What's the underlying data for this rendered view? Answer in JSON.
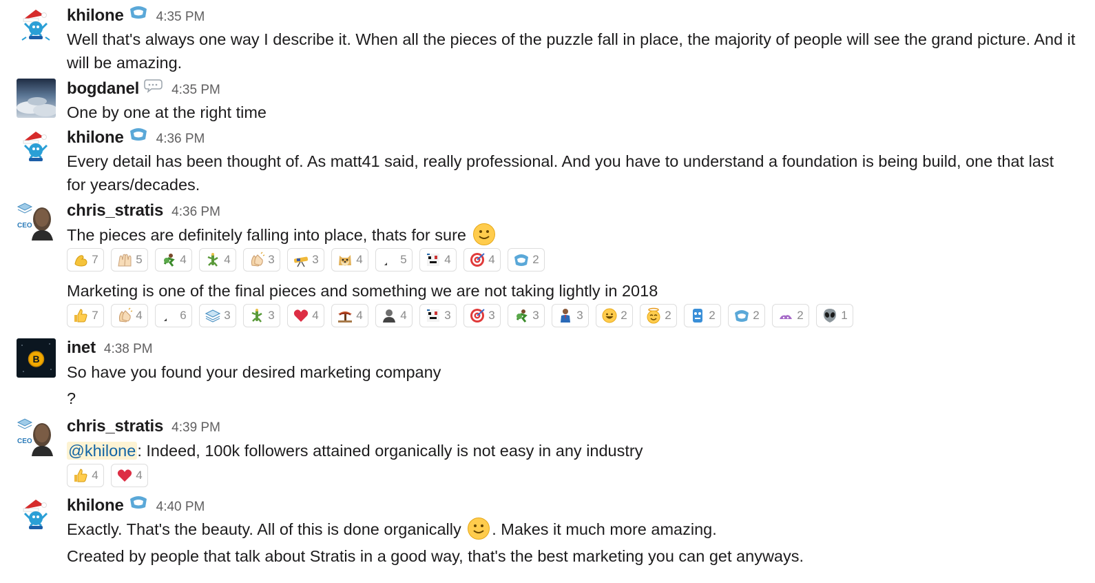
{
  "messages": [
    {
      "author": "khilone",
      "time": "4:35 PM",
      "lines": [
        "Well that's always one way I describe it. When all the pieces of the puzzle fall in place, the majority of people will see the grand picture. And it will be amazing."
      ]
    },
    {
      "author": "bogdanel",
      "time": "4:35 PM",
      "lines": [
        "One by one at the right time"
      ]
    },
    {
      "author": "khilone",
      "time": "4:36 PM",
      "lines": [
        "Every detail has been thought of. As matt41 said, really professional. And you have to understand a foundation is being build, one that last for years/decades."
      ]
    },
    {
      "author": "chris_stratis",
      "time": "4:36 PM",
      "line1": "The pieces are definitely falling into place, thats for sure",
      "reactions1": [
        {
          "icon": "flexed-biceps-icon",
          "count": "7"
        },
        {
          "icon": "raised-hands-icon",
          "count": "5"
        },
        {
          "icon": "dancer-icon",
          "count": "4"
        },
        {
          "icon": "cactus-dance-icon",
          "count": "4"
        },
        {
          "icon": "clapping-hands-icon",
          "count": "3"
        },
        {
          "icon": "telescope-icon",
          "count": "3"
        },
        {
          "icon": "doge-icon",
          "count": "4"
        },
        {
          "icon": "blank-emoji-icon",
          "count": "5"
        },
        {
          "icon": "face-glitch-icon",
          "count": "4"
        },
        {
          "icon": "target-icon",
          "count": "4"
        },
        {
          "icon": "stratis-logo-icon",
          "count": "2"
        }
      ],
      "line2": "Marketing is one of the final pieces and something we are not taking lightly in 2018",
      "reactions2": [
        {
          "icon": "thumbs-up-icon",
          "count": "7"
        },
        {
          "icon": "clapping-hands-icon",
          "count": "4"
        },
        {
          "icon": "blank-emoji-icon",
          "count": "6"
        },
        {
          "icon": "stratis-layers-icon",
          "count": "3"
        },
        {
          "icon": "cactus-dance-icon",
          "count": "3"
        },
        {
          "icon": "red-heart-icon",
          "count": "4"
        },
        {
          "icon": "tree-icon",
          "count": "4"
        },
        {
          "icon": "person-bust-icon",
          "count": "4"
        },
        {
          "icon": "face-glitch-icon",
          "count": "3"
        },
        {
          "icon": "target-icon",
          "count": "3"
        },
        {
          "icon": "dancer-icon",
          "count": "3"
        },
        {
          "icon": "businessman-icon",
          "count": "3"
        },
        {
          "icon": "grinning-face-icon",
          "count": "2"
        },
        {
          "icon": "smiling-halo-face-icon",
          "count": "2"
        },
        {
          "icon": "blue-mask-icon",
          "count": "2"
        },
        {
          "icon": "stratis-logo-icon",
          "count": "2"
        },
        {
          "icon": "purple-blob-icon",
          "count": "2"
        },
        {
          "icon": "alien-icon",
          "count": "1"
        }
      ]
    },
    {
      "author": "inet",
      "time": "4:38 PM",
      "lines": [
        "So have you found your desired marketing company",
        "?"
      ]
    },
    {
      "author": "chris_stratis",
      "time": "4:39 PM",
      "mention": "@khilone",
      "line_rest": ": Indeed, 100k followers attained organically is not easy in any industry",
      "reactions": [
        {
          "icon": "thumbs-up-icon",
          "count": "4"
        },
        {
          "icon": "red-heart-icon",
          "count": "4"
        }
      ]
    },
    {
      "author": "khilone",
      "time": "4:40 PM",
      "line1_a": "Exactly. That's the beauty. All of this is done organically ",
      "line1_b": ". Makes it much more amazing.",
      "line2": "Created by people that talk about Stratis in a good way, that's the best marketing you can get anyways."
    }
  ],
  "colors": {
    "mention_bg": "#fdf3d3",
    "mention_text": "#1264a3",
    "timestamp": "#616061",
    "reaction_border": "#dddddd"
  }
}
